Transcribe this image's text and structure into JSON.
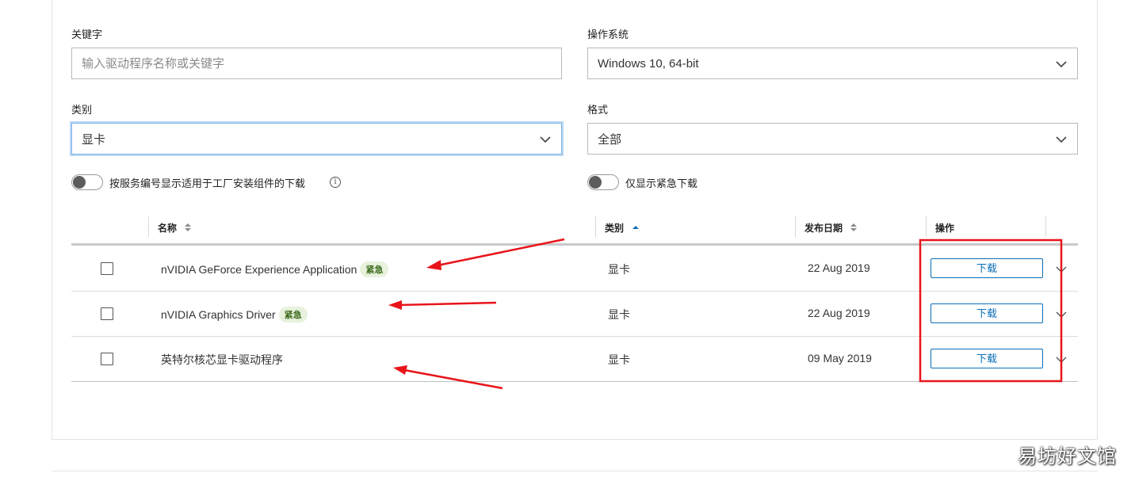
{
  "filters": {
    "keyword": {
      "label": "关键字",
      "placeholder": "输入驱动程序名称或关键字",
      "value": ""
    },
    "os": {
      "label": "操作系统",
      "value": "Windows 10, 64-bit"
    },
    "category": {
      "label": "类别",
      "value": "显卡"
    },
    "format": {
      "label": "格式",
      "value": "全部"
    },
    "toggle_service_tag": {
      "label": "按服务编号显示适用于工厂安装组件的下载",
      "on": false
    },
    "toggle_urgent": {
      "label": "仅显示紧急下载",
      "on": false
    }
  },
  "table": {
    "headers": {
      "name": "名称",
      "category": "类别",
      "date": "发布日期",
      "action": "操作"
    },
    "rows": [
      {
        "name": "nVIDIA GeForce Experience Application",
        "badge": "紧急",
        "category": "显卡",
        "date": "22 Aug 2019",
        "action": "下载"
      },
      {
        "name": "nVIDIA Graphics Driver",
        "badge": "紧急",
        "category": "显卡",
        "date": "22 Aug 2019",
        "action": "下载"
      },
      {
        "name": "英特尔核芯显卡驱动程序",
        "badge": "",
        "category": "显卡",
        "date": "09 May 2019",
        "action": "下载"
      }
    ]
  },
  "watermark": "易坊好文馆",
  "colors": {
    "accent": "#0b6fb8",
    "annotation": "#e8141a",
    "badge_bg": "#e7f1dc",
    "badge_text": "#3d6b1c"
  }
}
